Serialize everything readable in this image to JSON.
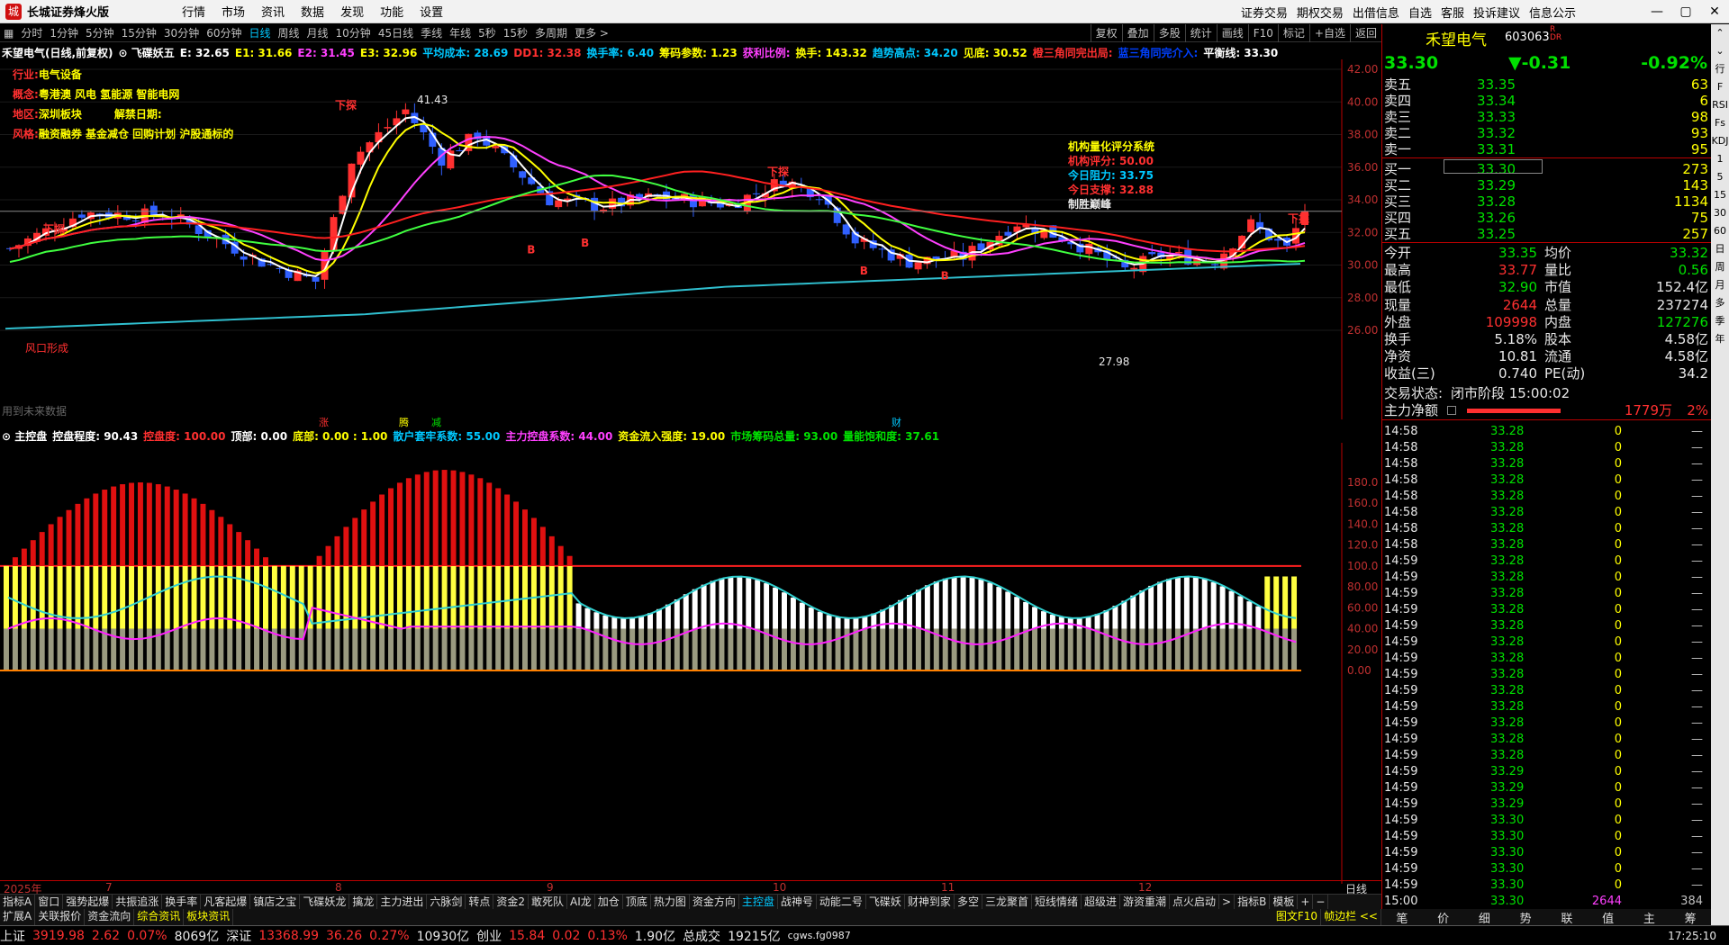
{
  "window": {
    "logo_text": "城",
    "title": "长城证券烽火版",
    "menu": [
      "行情",
      "市场",
      "资讯",
      "数据",
      "发现",
      "功能",
      "设置"
    ],
    "right_menu": [
      "证券交易",
      "期权交易",
      "出借信息",
      "自选",
      "客服",
      "投诉建议",
      "信息公示"
    ],
    "controls": [
      "—",
      "▢",
      "✕"
    ]
  },
  "periods": [
    "分时",
    "1分钟",
    "5分钟",
    "15分钟",
    "30分钟",
    "60分钟",
    "日线",
    "周线",
    "月线",
    "10分钟",
    "45日线",
    "季线",
    "年线",
    "5秒",
    "15秒",
    "多周期",
    "更多 >"
  ],
  "active_period": "日线",
  "top_right_buttons": [
    "复权",
    "叠加",
    "多股",
    "统计",
    "画线",
    "F10",
    "标记",
    "+自选",
    "返回"
  ],
  "indicator_line": [
    {
      "text": "禾望电气(日线,前复权)",
      "color": "#ffffff"
    },
    {
      "text": "⊙ 飞碟妖五",
      "color": "#ffffff"
    },
    {
      "text": "E: 32.65",
      "color": "#ffffff"
    },
    {
      "text": "E1: 31.66",
      "color": "#ffff00"
    },
    {
      "text": "E2: 31.45",
      "color": "#ff40ff"
    },
    {
      "text": "E3: 32.96",
      "color": "#ffff00"
    },
    {
      "text": "平均成本: 28.69",
      "color": "#00c8ff"
    },
    {
      "text": "DD1: 32.38",
      "color": "#ff3030"
    },
    {
      "text": "换手率: 6.40",
      "color": "#00c8ff"
    },
    {
      "text": "筹码参数: 1.23",
      "color": "#ffff00"
    },
    {
      "text": "获利比例:",
      "color": "#ff40ff"
    },
    {
      "text": "换手: 143.32",
      "color": "#ffff00"
    },
    {
      "text": "趋势高点: 34.20",
      "color": "#00c8ff"
    },
    {
      "text": "见底: 30.52",
      "color": "#ffff00"
    },
    {
      "text": "橙三角同完出局:",
      "color": "#ff3030"
    },
    {
      "text": "蓝三角同完介入:",
      "color": "#0040ff"
    },
    {
      "text": "平衡线: 33.30",
      "color": "#ffffff"
    }
  ],
  "info_labels": [
    {
      "label": "行业:",
      "value": "电气设备"
    },
    {
      "label": "概念:",
      "value": "粤港澳 风电 氢能源 智能电网"
    },
    {
      "label": "地区:",
      "value": "深圳板块",
      "extra": "解禁日期:"
    },
    {
      "label": "风格:",
      "value": "融资融券 基金减仓 回购计划 沪股通标的"
    }
  ],
  "score_box": {
    "title": "机构量化评分系统",
    "score_label": "机构评分:",
    "score": "50.00",
    "resist_label": "今日阻力:",
    "resist": "33.75",
    "support_label": "今日支撑:",
    "support": "32.88",
    "note": "制胜巅峰"
  },
  "annotations": {
    "high": "41.43",
    "low": "27.98",
    "fengkou": "风口形成",
    "future": "用到未来数据",
    "xiatan": "下探",
    "buy": "B",
    "events": [
      "涨",
      "腾",
      "减",
      "财"
    ]
  },
  "price_axis": [
    "42.00",
    "40.00",
    "38.00",
    "36.00",
    "34.00",
    "32.00",
    "30.00",
    "28.00",
    "26.00"
  ],
  "sub_header": [
    {
      "text": "⊙ 主控盘",
      "color": "#ffffff"
    },
    {
      "text": "控盘程度: 90.43",
      "color": "#ffffff"
    },
    {
      "text": "控盘度: 100.00",
      "color": "#ff3030"
    },
    {
      "text": "顶部: 0.00",
      "color": "#ffffff"
    },
    {
      "text": "底部: 0.00 : 1.00",
      "color": "#ffff00"
    },
    {
      "text": "散户套牢系数: 55.00",
      "color": "#00c8ff"
    },
    {
      "text": "主力控盘系数: 44.00",
      "color": "#ff40ff"
    },
    {
      "text": "资金流入强度: 19.00",
      "color": "#ffff00"
    },
    {
      "text": "市场筹码总量: 93.00",
      "color": "#00e000"
    },
    {
      "text": "量能饱和度: 37.61",
      "color": "#00e000"
    }
  ],
  "sub_axis": [
    "180.0",
    "160.0",
    "140.0",
    "120.0",
    "100.0",
    "80.00",
    "60.00",
    "40.00",
    "20.00",
    "0.00"
  ],
  "x_labels": [
    "2025年",
    "7",
    "8",
    "9",
    "10",
    "11",
    "12"
  ],
  "x_label_right": "日线",
  "tabs1": [
    "指标A",
    "窗口",
    "强势起爆",
    "共振追涨",
    "换手率",
    "凡客起爆",
    "镇店之宝",
    "飞碟妖龙",
    "擒龙",
    "主力进出",
    "六脉剑",
    "转点",
    "资金2",
    "敢死队",
    "AI龙",
    "加仓",
    "顶底",
    "热力图",
    "资金方向",
    "主控盘",
    "战神号",
    "动能二号",
    "飞碟妖",
    "财神到家",
    "多空",
    "三龙聚首",
    "短线情绪",
    "超级进",
    "游资重潮",
    "点火启动",
    ">",
    "指标B",
    "模板",
    "+",
    "−"
  ],
  "active_tab": "主控盘",
  "tabs2": [
    "扩展A",
    "关联报价",
    "资金流向",
    "综合资讯",
    "板块资讯"
  ],
  "tabs2_right": [
    "图文F10",
    "帧边栏 <<"
  ],
  "quote": {
    "name": "禾望电气",
    "code": "603063",
    "rmark": "R\nDR",
    "price": "33.30",
    "change": "▼-0.31",
    "pct": "-0.92%",
    "sells": [
      [
        "卖五",
        "33.35",
        "63"
      ],
      [
        "卖四",
        "33.34",
        "6"
      ],
      [
        "卖三",
        "33.33",
        "98"
      ],
      [
        "卖二",
        "33.32",
        "93"
      ],
      [
        "卖一",
        "33.31",
        "95"
      ]
    ],
    "buys": [
      [
        "买一",
        "33.30",
        "273"
      ],
      [
        "买二",
        "33.29",
        "143"
      ],
      [
        "买三",
        "33.28",
        "1134"
      ],
      [
        "买四",
        "33.26",
        "75"
      ],
      [
        "买五",
        "33.25",
        "257"
      ]
    ],
    "stats": [
      [
        "今开",
        "33.35",
        "均价",
        "33.32"
      ],
      [
        "最高",
        "33.77",
        "量比",
        "0.56"
      ],
      [
        "最低",
        "32.90",
        "市值",
        "152.4亿"
      ],
      [
        "现量",
        "2644",
        "总量",
        "237274"
      ],
      [
        "外盘",
        "109998",
        "内盘",
        "127276"
      ],
      [
        "换手",
        "5.18%",
        "股本",
        "4.58亿"
      ],
      [
        "净资",
        "10.81",
        "流通",
        "4.58亿"
      ],
      [
        "收益(三)",
        "0.740",
        "PE(动)",
        "34.2"
      ]
    ],
    "state_label": "交易状态:",
    "state": "闭市阶段 15:00:02",
    "flow_label": "主力净额",
    "flow_value": "1779万",
    "flow_pct": "2%"
  },
  "ticks": [
    [
      "14:58",
      "33.28",
      "0",
      "—"
    ],
    [
      "14:58",
      "33.28",
      "0",
      "—"
    ],
    [
      "14:58",
      "33.28",
      "0",
      "—"
    ],
    [
      "14:58",
      "33.28",
      "0",
      "—"
    ],
    [
      "14:58",
      "33.28",
      "0",
      "—"
    ],
    [
      "14:58",
      "33.28",
      "0",
      "—"
    ],
    [
      "14:58",
      "33.28",
      "0",
      "—"
    ],
    [
      "14:58",
      "33.28",
      "0",
      "—"
    ],
    [
      "14:59",
      "33.28",
      "0",
      "—"
    ],
    [
      "14:59",
      "33.28",
      "0",
      "—"
    ],
    [
      "14:59",
      "33.28",
      "0",
      "—"
    ],
    [
      "14:59",
      "33.28",
      "0",
      "—"
    ],
    [
      "14:59",
      "33.28",
      "0",
      "—"
    ],
    [
      "14:59",
      "33.28",
      "0",
      "—"
    ],
    [
      "14:59",
      "33.28",
      "0",
      "—"
    ],
    [
      "14:59",
      "33.28",
      "0",
      "—"
    ],
    [
      "14:59",
      "33.28",
      "0",
      "—"
    ],
    [
      "14:59",
      "33.28",
      "0",
      "—"
    ],
    [
      "14:59",
      "33.28",
      "0",
      "—"
    ],
    [
      "14:59",
      "33.28",
      "0",
      "—"
    ],
    [
      "14:59",
      "33.28",
      "0",
      "—"
    ],
    [
      "14:59",
      "33.29",
      "0",
      "—"
    ],
    [
      "14:59",
      "33.29",
      "0",
      "—"
    ],
    [
      "14:59",
      "33.29",
      "0",
      "—"
    ],
    [
      "14:59",
      "33.30",
      "0",
      "—"
    ],
    [
      "14:59",
      "33.30",
      "0",
      "—"
    ],
    [
      "14:59",
      "33.30",
      "0",
      "—"
    ],
    [
      "14:59",
      "33.30",
      "0",
      "—"
    ],
    [
      "14:59",
      "33.30",
      "0",
      "—"
    ],
    [
      "15:00",
      "33.30",
      "2644",
      "384"
    ]
  ],
  "right_tabs": [
    "笔",
    "价",
    "细",
    "势",
    "联",
    "值",
    "主",
    "筹"
  ],
  "sidebar": [
    "⌃",
    "⌄",
    "行",
    "F",
    "RSI",
    "Fs",
    "KDJ",
    "1",
    "5",
    "15",
    "30",
    "60",
    "日",
    "周",
    "月",
    "多",
    "季",
    "年"
  ],
  "status": {
    "sh_label": "上证",
    "sh": "3919.98",
    "sh_chg": "2.62",
    "sh_pct": "0.07%",
    "sh_amt": "8069亿",
    "sz_label": "深证",
    "sz": "13368.99",
    "sz_chg": "36.26",
    "sz_pct": "0.27%",
    "sz_amt": "10930亿",
    "cy_label": "创业",
    "cy": "15.84",
    "cy_chg": "0.02",
    "cy_pct": "0.13%",
    "cy_amt": "1.90亿",
    "total_label": "总成交",
    "total": "19215亿",
    "server": "cgws.fg0987",
    "time": "17:25:10"
  },
  "colors": {
    "up": "#ff3030",
    "down": "#00e000",
    "accent": "#00c8ff",
    "yellow": "#ffff00",
    "magenta": "#ff40ff"
  }
}
